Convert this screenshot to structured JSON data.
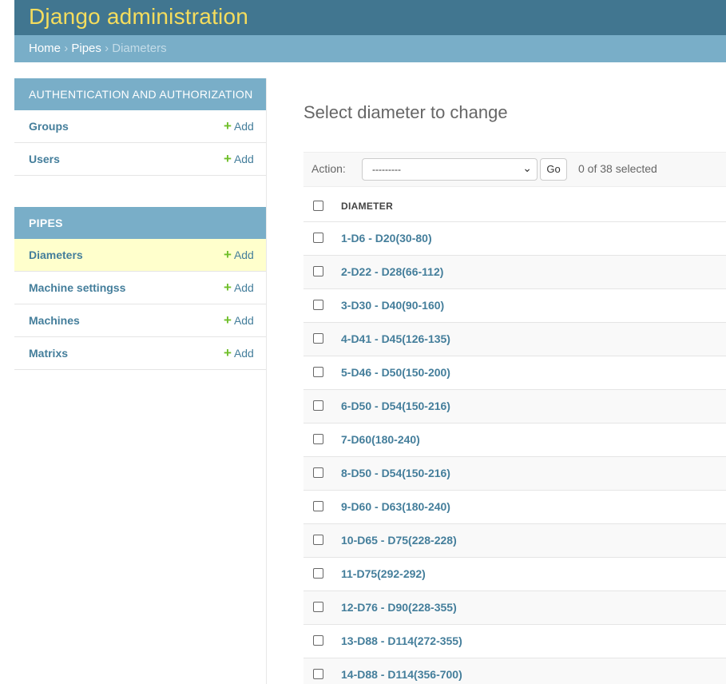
{
  "header": {
    "title": "Django administration"
  },
  "breadcrumbs": {
    "home": "Home",
    "separator": "›",
    "app": "Pipes",
    "current": "Diameters"
  },
  "sidebar": {
    "auth_caption": "AUTHENTICATION AND AUTHORIZATION",
    "auth_models": [
      {
        "name": "Groups",
        "add": "Add"
      },
      {
        "name": "Users",
        "add": "Add"
      }
    ],
    "pipes_caption": "PIPES",
    "pipes_models": [
      {
        "name": "Diameters",
        "add": "Add"
      },
      {
        "name": "Machine settingss",
        "add": "Add"
      },
      {
        "name": "Machines",
        "add": "Add"
      },
      {
        "name": "Matrixs",
        "add": "Add"
      }
    ]
  },
  "content": {
    "title": "Select diameter to change",
    "action_label": "Action:",
    "action_selected": "---------",
    "go_label": "Go",
    "selected_count": "0 of 38 selected",
    "column_header": "DIAMETER",
    "rows": [
      "1-D6 - D20(30-80)",
      "2-D22 - D28(66-112)",
      "3-D30 - D40(90-160)",
      "4-D41 - D45(126-135)",
      "5-D46 - D50(150-200)",
      "6-D50 - D54(150-216)",
      "7-D60(180-240)",
      "8-D50 - D54(150-216)",
      "9-D60 - D63(180-240)",
      "10-D65 - D75(228-228)",
      "11-D75(292-292)",
      "12-D76 - D90(228-355)",
      "13-D88 - D114(272-355)",
      "14-D88 - D114(356-700)"
    ]
  },
  "colors": {
    "header_bg": "#417690",
    "breadcrumb_bg": "#79aec8",
    "title_yellow": "#f5dd5d",
    "link_blue": "#447e9b",
    "add_green": "#70bf2b",
    "active_row": "#ffffcc"
  },
  "icons": {
    "add": "plus-icon",
    "select": "chevron-down-icon",
    "checkbox": "checkbox-icon"
  }
}
